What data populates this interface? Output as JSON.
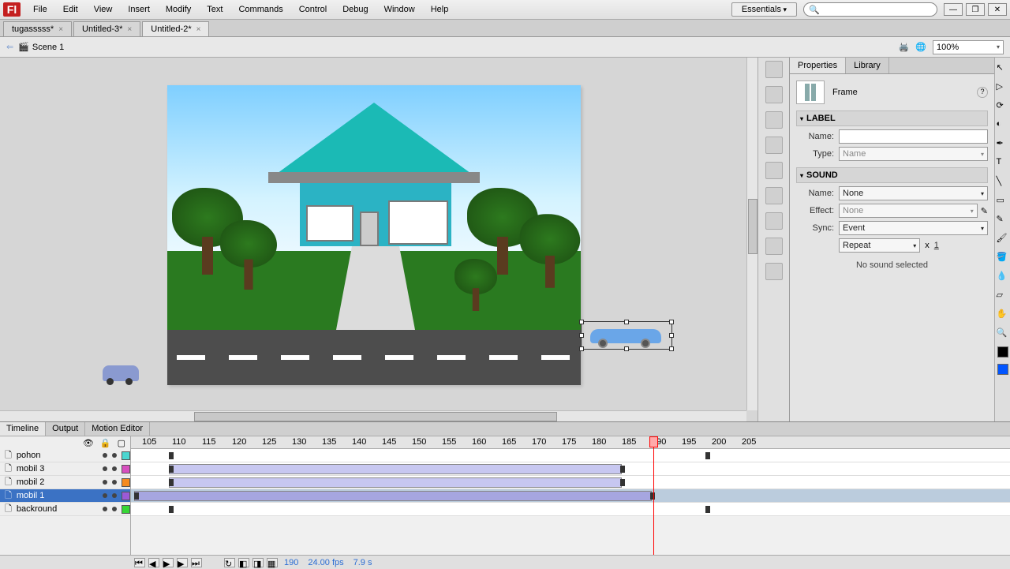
{
  "menus": [
    "File",
    "Edit",
    "View",
    "Insert",
    "Modify",
    "Text",
    "Commands",
    "Control",
    "Debug",
    "Window",
    "Help"
  ],
  "workspace": "Essentials",
  "tabs": [
    {
      "label": "tugasssss*",
      "active": false
    },
    {
      "label": "Untitled-3*",
      "active": false
    },
    {
      "label": "Untitled-2*",
      "active": true
    }
  ],
  "scene": {
    "name": "Scene 1",
    "zoom": "100%"
  },
  "properties": {
    "tabs": [
      "Properties",
      "Library"
    ],
    "title": "Frame",
    "label": {
      "section": "LABEL",
      "name_lbl": "Name:",
      "name_val": "",
      "type_lbl": "Type:",
      "type_val": "Name"
    },
    "sound": {
      "section": "SOUND",
      "name_lbl": "Name:",
      "name_val": "None",
      "effect_lbl": "Effect:",
      "effect_val": "None",
      "sync_lbl": "Sync:",
      "sync_val": "Event",
      "repeat": "Repeat",
      "x": "x",
      "count": "1",
      "empty": "No sound selected"
    }
  },
  "timeline": {
    "tabs": [
      "Timeline",
      "Output",
      "Motion Editor"
    ],
    "layers": [
      {
        "name": "pohon",
        "color": "#4ad6d0",
        "sel": false
      },
      {
        "name": "mobil 3",
        "color": "#d74fbf",
        "sel": false
      },
      {
        "name": "mobil 2",
        "color": "#f58a1f",
        "sel": false
      },
      {
        "name": "mobil 1",
        "color": "#9b5ad6",
        "sel": true
      },
      {
        "name": "backround",
        "color": "#36d636",
        "sel": false
      }
    ],
    "ruler": [
      105,
      110,
      115,
      120,
      125,
      130,
      135,
      140,
      145,
      150,
      155,
      160,
      165,
      170,
      175,
      180,
      185,
      190,
      195,
      200,
      205
    ],
    "footer": {
      "frame": "190",
      "fps": "24.00 fps",
      "time": "7.9 s"
    }
  }
}
